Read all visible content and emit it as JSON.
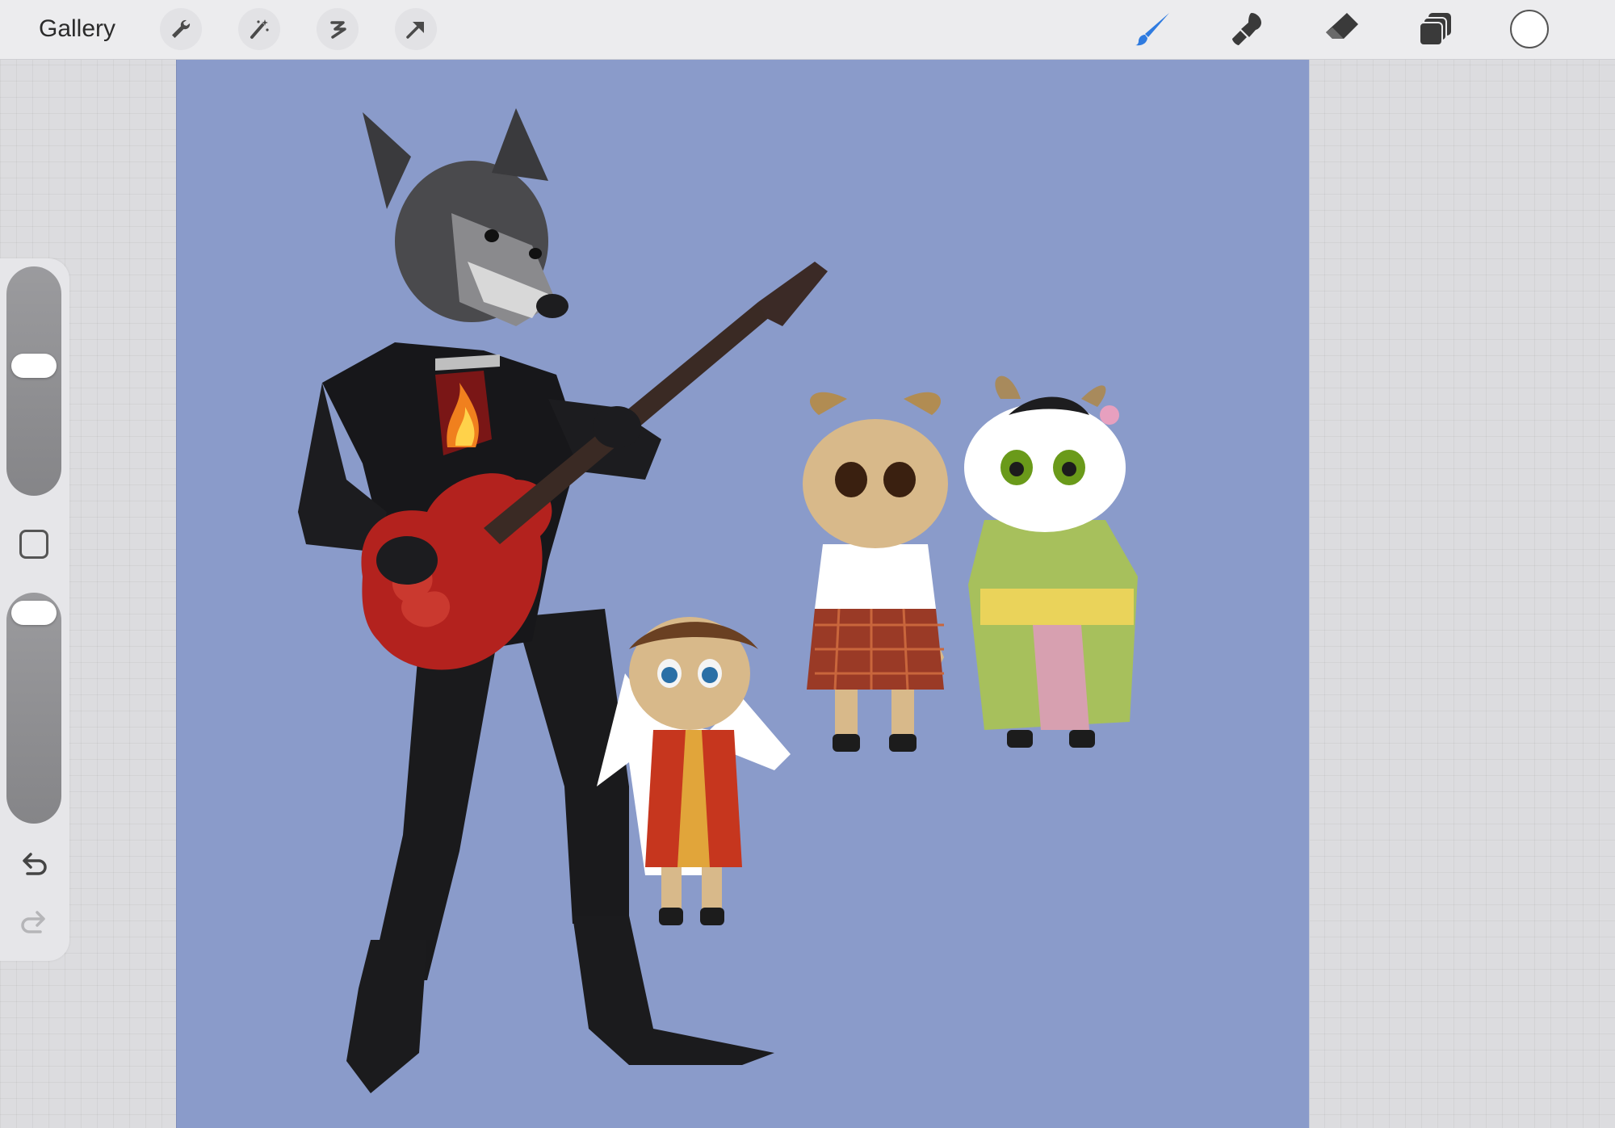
{
  "toolbar": {
    "gallery_label": "Gallery",
    "left_tools": [
      "wrench-icon",
      "magic-wand-icon",
      "selection-icon",
      "transform-arrow-icon"
    ],
    "right_tools": [
      "brush-icon",
      "smudge-icon",
      "eraser-icon",
      "layers-icon"
    ],
    "active_tool": "brush",
    "active_color": "#ffffff",
    "accent_color": "#2f7be0"
  },
  "canvas": {
    "background_color": "#8a9bca",
    "artwork": "wolf-guitarist-and-three-goats"
  },
  "sidebar": {
    "brush_size_level": 0.55,
    "opacity_level": 0.95,
    "undo_icon": "undo-arrow-icon",
    "redo_icon": "redo-arrow-icon"
  }
}
